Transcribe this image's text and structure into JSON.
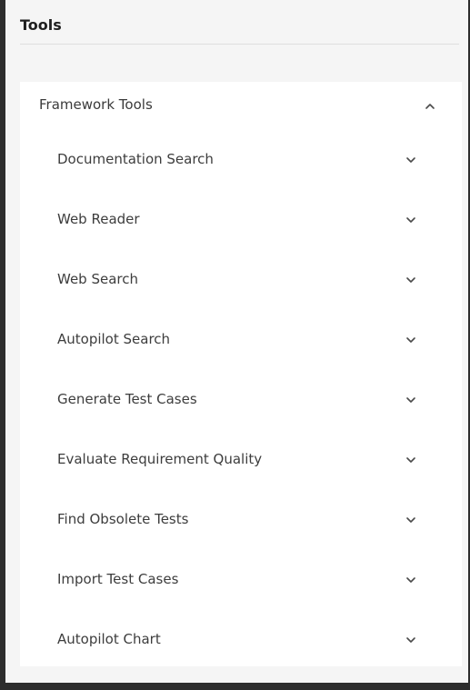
{
  "panel": {
    "title": "Tools"
  },
  "section": {
    "label": "Framework Tools",
    "expanded": true,
    "toggle_icon": "chevron-up-icon"
  },
  "items": [
    {
      "label": "Documentation Search",
      "icon": "chevron-down-icon"
    },
    {
      "label": "Web Reader",
      "icon": "chevron-down-icon"
    },
    {
      "label": "Web Search",
      "icon": "chevron-down-icon"
    },
    {
      "label": "Autopilot Search",
      "icon": "chevron-down-icon"
    },
    {
      "label": "Generate Test Cases",
      "icon": "chevron-down-icon"
    },
    {
      "label": "Evaluate Requirement Quality",
      "icon": "chevron-down-icon"
    },
    {
      "label": "Find Obsolete Tests",
      "icon": "chevron-down-icon"
    },
    {
      "label": "Import Test Cases",
      "icon": "chevron-down-icon"
    },
    {
      "label": "Autopilot Chart",
      "icon": "chevron-down-icon"
    }
  ],
  "colors": {
    "frame": "#2d2d2d",
    "panel_bg": "#f5f5f5",
    "card_bg": "#ffffff",
    "text": "#3d3d3d"
  }
}
